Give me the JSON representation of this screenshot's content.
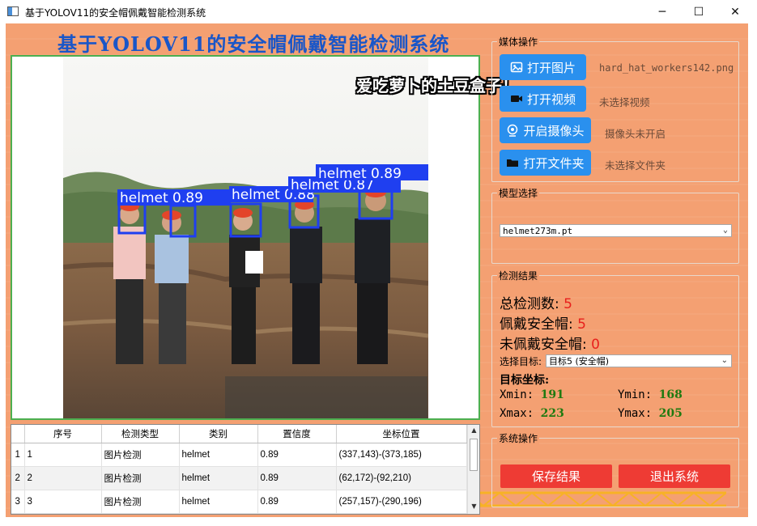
{
  "window": {
    "title": "基于YOLOV11的安全帽佩戴智能检测系统",
    "minimize": "─",
    "maximize": "☐",
    "close": "✕"
  },
  "app": {
    "heading": "基于YOLOV11的安全帽佩戴智能检测系统",
    "watermark": "爱吃萝卜的土豆盒子！"
  },
  "detections_overlay": [
    {
      "label": "helmet 0.89"
    },
    {
      "label": "helmet 0.89"
    },
    {
      "label": "helmet 0.88"
    },
    {
      "label": "helmet 0.87"
    },
    {
      "label": "helmet 0.89"
    }
  ],
  "media": {
    "group_title": "媒体操作",
    "open_image": "打开图片",
    "open_image_status": "hard_hat_workers142.png",
    "open_video": "打开视频",
    "open_video_status": "未选择视频",
    "open_camera": "开启摄像头",
    "open_camera_status": "摄像头未开启",
    "open_folder": "打开文件夹",
    "open_folder_status": "未选择文件夹"
  },
  "model": {
    "group_title": "模型选择",
    "selected": "helmet273m.pt"
  },
  "results": {
    "group_title": "检测结果",
    "total_label": "总检测数:",
    "total_value": "5",
    "wearing_label": "佩戴安全帽:",
    "wearing_value": "5",
    "not_wearing_label": "未佩戴安全帽:",
    "not_wearing_value": "0",
    "target_label": "选择目标:",
    "target_selected": "目标5 (安全帽)",
    "coords_title": "目标坐标:",
    "xmin_label": "Xmin:",
    "xmin": "191",
    "ymin_label": "Ymin:",
    "ymin": "168",
    "xmax_label": "Xmax:",
    "xmax": "223",
    "ymax_label": "Ymax:",
    "ymax": "205"
  },
  "system": {
    "group_title": "系统操作",
    "save": "保存结果",
    "exit": "退出系统"
  },
  "table": {
    "headers": [
      "序号",
      "检测类型",
      "类别",
      "置信度",
      "坐标位置"
    ],
    "rows": [
      {
        "rownum": "1",
        "id": "1",
        "type": "图片检测",
        "cls": "helmet",
        "conf": "0.89",
        "coords": "(337,143)-(373,185)"
      },
      {
        "rownum": "2",
        "id": "2",
        "type": "图片检测",
        "cls": "helmet",
        "conf": "0.89",
        "coords": "(62,172)-(92,210)"
      },
      {
        "rownum": "3",
        "id": "3",
        "type": "图片检测",
        "cls": "helmet",
        "conf": "0.89",
        "coords": "(257,157)-(290,196)"
      }
    ]
  },
  "colors": {
    "accent_blue": "#2a90ee",
    "danger_red": "#ee3b34",
    "background_orange": "#f4a072",
    "title_blue": "#1a56c8",
    "value_green": "#207a10",
    "detection_box": "#1f3ff0"
  }
}
